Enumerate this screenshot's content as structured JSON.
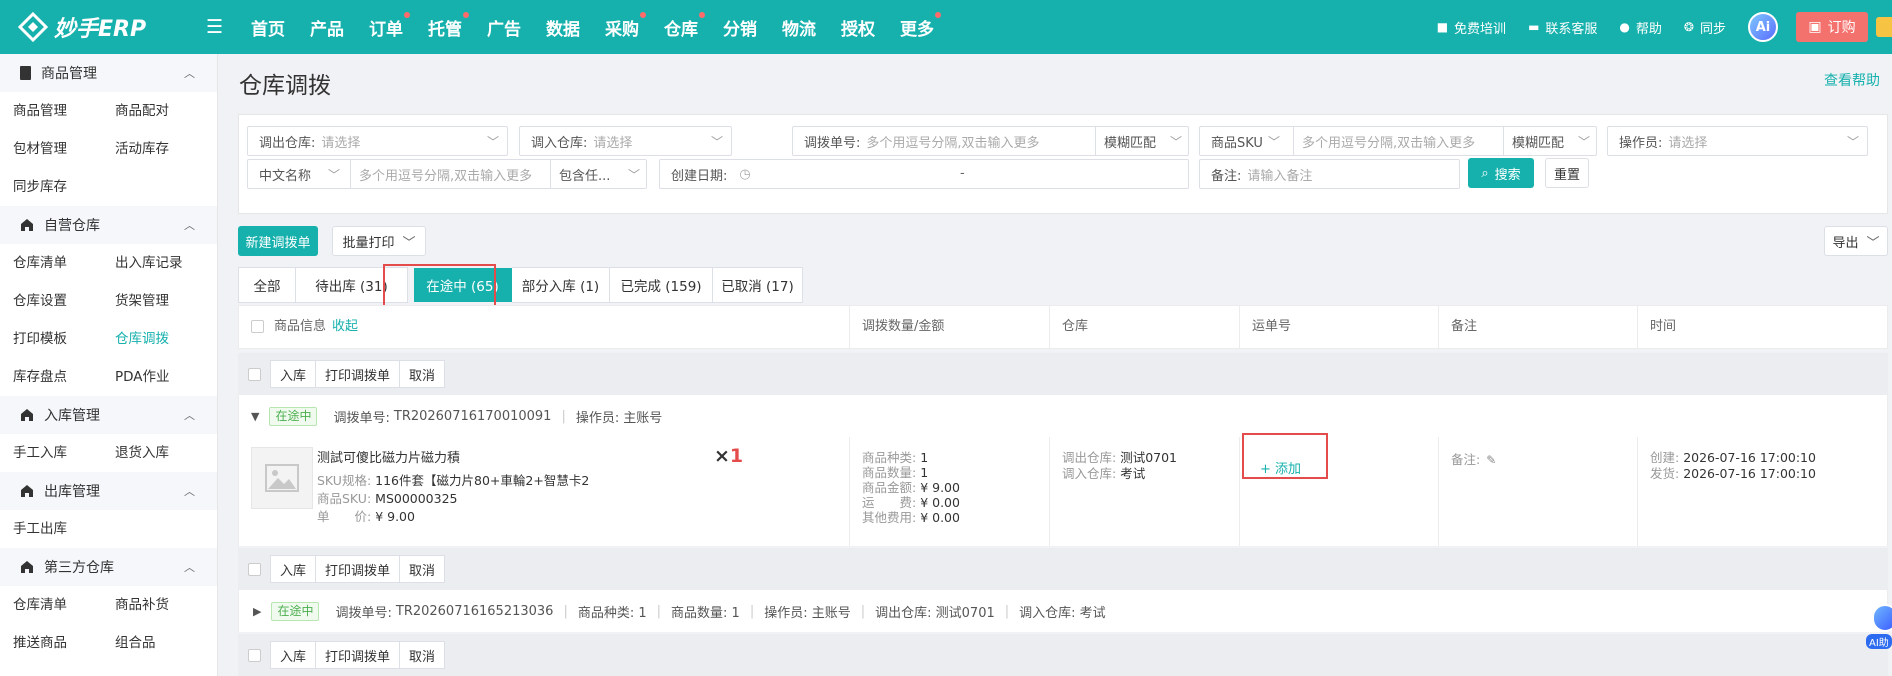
{
  "brand": {
    "logo": "妙手ERP",
    "accent": "#17b1ad"
  },
  "nav": {
    "items": [
      {
        "label": "首页",
        "dot": false
      },
      {
        "label": "产品",
        "dot": false
      },
      {
        "label": "订单",
        "dot": true
      },
      {
        "label": "托管",
        "dot": true
      },
      {
        "label": "广告",
        "dot": false
      },
      {
        "label": "数据",
        "dot": false
      },
      {
        "label": "采购",
        "dot": true
      },
      {
        "label": "仓库",
        "dot": true
      },
      {
        "label": "分销",
        "dot": false
      },
      {
        "label": "物流",
        "dot": false
      },
      {
        "label": "授权",
        "dot": false
      },
      {
        "label": "更多",
        "dot": true
      }
    ]
  },
  "top_right": {
    "training": "免费培训",
    "support": "联系客服",
    "help": "帮助",
    "sync": "同步",
    "ai": "Ai",
    "order": "订购"
  },
  "sidebar": {
    "sections": [
      {
        "title": "商品管理",
        "icon": "clipboard-icon",
        "items": [
          "商品管理",
          "商品配对",
          "包材管理",
          "活动库存",
          "同步库存"
        ]
      },
      {
        "title": "自营仓库",
        "icon": "home-icon",
        "items": [
          "仓库清单",
          "出入库记录",
          "仓库设置",
          "货架管理",
          "打印模板",
          "仓库调拨",
          "库存盘点",
          "PDA作业"
        ]
      },
      {
        "title": "入库管理",
        "icon": "home-icon",
        "items": [
          "手工入库",
          "退货入库"
        ]
      },
      {
        "title": "出库管理",
        "icon": "home-icon",
        "items": [
          "手工出库"
        ]
      },
      {
        "title": "第三方仓库",
        "icon": "home-icon",
        "items": [
          "仓库清单",
          "商品补货",
          "推送商品",
          "组合品"
        ]
      }
    ],
    "active": "仓库调拨"
  },
  "page": {
    "title": "仓库调拨",
    "help": "查看帮助"
  },
  "filters": {
    "out_wh": {
      "label": "调出仓库:",
      "placeholder": "请选择"
    },
    "in_wh": {
      "label": "调入仓库:",
      "placeholder": "请选择"
    },
    "transfer_no": {
      "label": "调拨单号:",
      "placeholder": "多个用逗号分隔,双击输入更多",
      "mode": "模糊匹配"
    },
    "sku": {
      "label": "商品SKU",
      "placeholder": "多个用逗号分隔,双击输入更多",
      "mode": "模糊匹配"
    },
    "operator": {
      "label": "操作员:",
      "placeholder": "请选择"
    },
    "cn_name": {
      "label": "中文名称",
      "placeholder": "多个用逗号分隔,双击输入更多",
      "mode": "包含任..."
    },
    "date": {
      "label": "创建日期:",
      "sep": "-"
    },
    "remark": {
      "label": "备注:",
      "placeholder": "请输入备注"
    },
    "search": "搜索",
    "reset": "重置"
  },
  "actions": {
    "new": "新建调拨单",
    "batch_print": "批量打印",
    "export": "导出"
  },
  "tabs": [
    "全部",
    "待出库 (31)",
    "在途中 (65)",
    "部分入库 (1)",
    "已完成 (159)",
    "已取消 (17)"
  ],
  "active_tab": "在途中 (65)",
  "table": {
    "headers": {
      "product": "商品信息",
      "collapse": "收起",
      "qty_amount": "调拨数量/金额",
      "warehouse": "仓库",
      "tracking": "运单号",
      "remark": "备注",
      "time": "时间"
    }
  },
  "row_actions": [
    "入库",
    "打印调拨单",
    "取消"
  ],
  "order1": {
    "status": "在途中",
    "no_label": "调拨单号:",
    "no": "TR20260716170010091",
    "op_label": "操作员:",
    "op": "主账号",
    "product": {
      "name": "测試可傻比磁力片磁力積",
      "spec_k": "SKU规格:",
      "spec_v": "116件套【磁力片80+車輪2+智慧卡2",
      "sku_k": "商品SKU:",
      "sku_v": "MS00000325",
      "price_k": "单　　价:",
      "price_v": "¥ 9.00",
      "qty_prefix": "×",
      "qty": "1"
    },
    "stats": [
      {
        "k": "商品种类:",
        "v": "1"
      },
      {
        "k": "商品数量:",
        "v": "1"
      },
      {
        "k": "商品金额:",
        "v": "¥ 9.00"
      },
      {
        "k": "运　　费:",
        "v": "¥ 0.00"
      },
      {
        "k": "其他费用:",
        "v": "¥ 0.00"
      }
    ],
    "wh": {
      "out_k": "调出仓库:",
      "out_v": "测试0701",
      "in_k": "调入仓库:",
      "in_v": "考试"
    },
    "add": "+ 添加",
    "remark_k": "备注:",
    "time": {
      "created_k": "创建:",
      "created_v": "2026-07-16 17:00:10",
      "ship_k": "发货:",
      "ship_v": "2026-07-16 17:00:10"
    }
  },
  "order2": {
    "status": "在途中",
    "no_label": "调拨单号:",
    "no": "TR20260716165213036",
    "kinds": "商品种类:  1",
    "count": "商品数量:  1",
    "op": "操作员:  主账号",
    "out": "调出仓库:  测试0701",
    "in": "调入仓库:  考试"
  },
  "ai_float": "AI助"
}
